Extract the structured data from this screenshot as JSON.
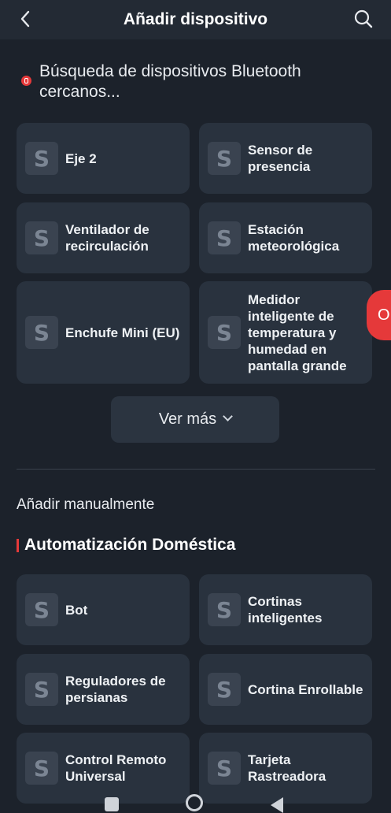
{
  "header": {
    "title": "Añadir dispositivo",
    "back_icon": "chevron-left-icon",
    "search_icon": "search-icon"
  },
  "scan": {
    "text": "Búsqueda de dispositivos Bluetooth cercanos..."
  },
  "nearby_devices": [
    {
      "label": "Eje 2",
      "icon": "S"
    },
    {
      "label": "Sensor de presencia",
      "icon": "S"
    },
    {
      "label": "Ventilador de recirculación",
      "icon": "S"
    },
    {
      "label": "Estación meteorológica",
      "icon": "S"
    },
    {
      "label": "Enchufe Mini (EU)",
      "icon": "S"
    },
    {
      "label": "Medidor inteligente de temperatura y humedad en pantalla grande",
      "icon": "S"
    }
  ],
  "more_button": {
    "label": "Ver más"
  },
  "manual": {
    "label": "Añadir manualmente"
  },
  "category": {
    "title": "Automatización Doméstica",
    "items": [
      {
        "label": "Bot",
        "icon": "S"
      },
      {
        "label": "Cortinas inteligentes",
        "icon": "S"
      },
      {
        "label": "Reguladores de persianas",
        "icon": "S"
      },
      {
        "label": "Cortina Enrollable",
        "icon": "S"
      },
      {
        "label": "Control Remoto Universal",
        "icon": "S"
      },
      {
        "label": "Tarjeta Rastreadora",
        "icon": "S"
      }
    ]
  },
  "floating_badge": {
    "text": "O"
  },
  "colors": {
    "background": "#1c222b",
    "card": "#29323e",
    "accent": "#e5393a"
  }
}
